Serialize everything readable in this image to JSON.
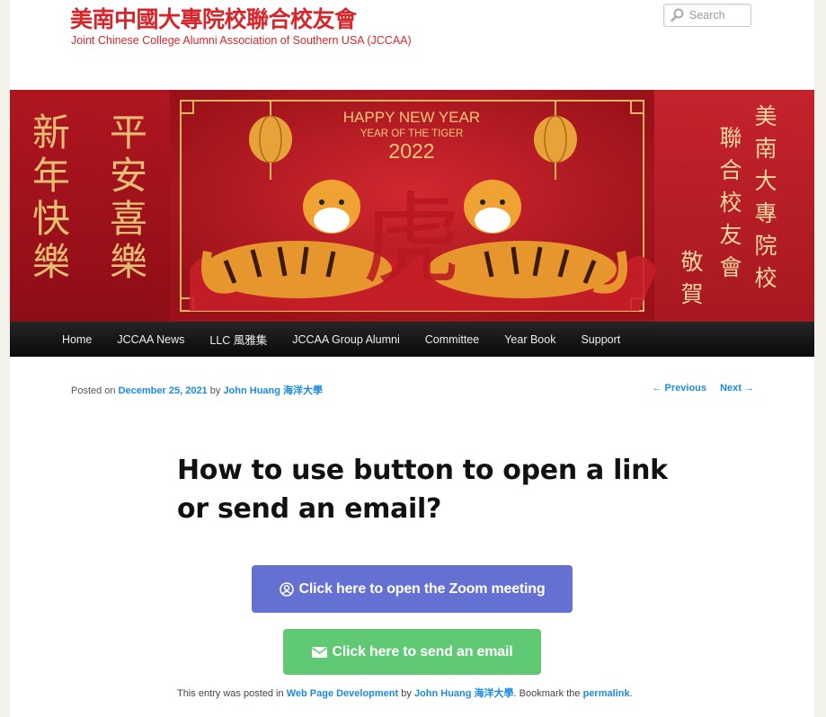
{
  "header": {
    "site_title": "美南中國大專院校聯合校友會",
    "site_description": "Joint Chinese College Alumni Association of Southern USA (JCCAA)",
    "search_placeholder": "Search"
  },
  "banner": {
    "left_couplet_1": "新年快樂",
    "left_couplet_2": "平安喜樂",
    "headline": "HAPPY NEW YEAR",
    "subline": "YEAR OF THE TIGER",
    "year": "2022",
    "center_glyph": "虎",
    "right_col_1": "美南大專院校",
    "right_col_2": "聯合校友會",
    "right_col_3": "敬賀"
  },
  "nav": {
    "items": [
      "Home",
      "JCCAA News",
      "LLC 風雅集",
      "JCCAA Group Alumni",
      "Committee",
      "Year Book",
      "Support"
    ]
  },
  "post_meta": {
    "posted_on": "Posted on",
    "date": "December 25, 2021",
    "by": "by",
    "author": "John Huang 海洋大學",
    "previous": "← Previous",
    "next": "Next →"
  },
  "post": {
    "title": "How to use button to open a link or send an email?",
    "zoom_button": "Click here to open the Zoom meeting",
    "email_button": "Click here to send an email"
  },
  "footer": {
    "prefix": "This entry was posted in",
    "category": "Web Page Development",
    "by": "by",
    "author": "John Huang 海洋大學",
    "bookmark": ". Bookmark the",
    "permalink": "permalink",
    "end": "."
  },
  "colors": {
    "title_red": "#d7262b",
    "link_blue": "#1b8be0",
    "zoom_button": "#6470d2",
    "email_button": "#5fc974",
    "nav_bg": "#111111"
  }
}
